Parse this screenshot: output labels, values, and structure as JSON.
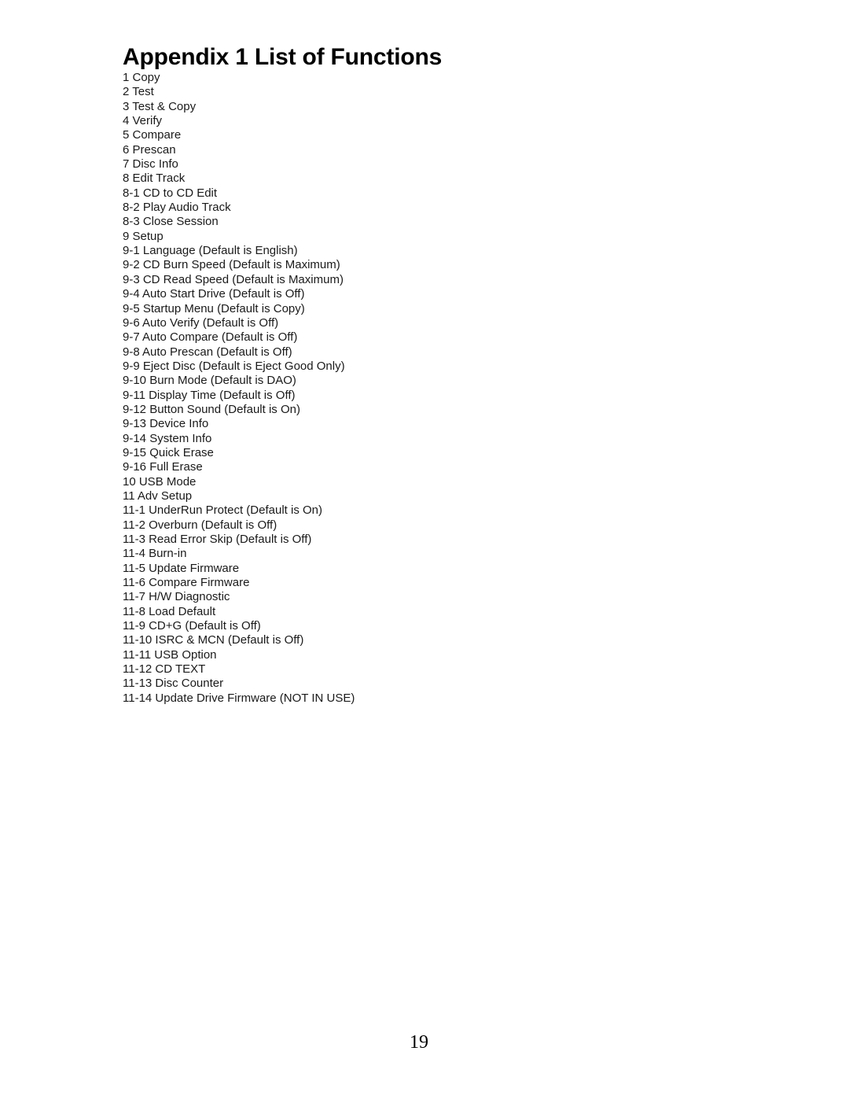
{
  "document": {
    "title": "Appendix 1 List of Functions",
    "page_number": "19",
    "background_color": "#ffffff",
    "text_color": "#1a1a1a"
  },
  "functions": [
    {
      "label": "1 Copy"
    },
    {
      "label": "2 Test"
    },
    {
      "label": "3 Test & Copy"
    },
    {
      "label": "4 Verify"
    },
    {
      "label": "5 Compare"
    },
    {
      "label": "6 Prescan"
    },
    {
      "label": "7 Disc Info"
    },
    {
      "label": "8 Edit Track"
    },
    {
      "label": "8-1 CD to CD Edit"
    },
    {
      "label": "8-2 Play Audio Track"
    },
    {
      "label": "8-3 Close Session"
    },
    {
      "label": "9 Setup"
    },
    {
      "label": "9-1 Language (Default is English)"
    },
    {
      "label": "9-2 CD Burn Speed (Default is Maximum)"
    },
    {
      "label": "9-3 CD Read Speed (Default is Maximum)"
    },
    {
      "label": "9-4 Auto Start Drive (Default is Off)"
    },
    {
      "label": "9-5 Startup Menu (Default is Copy)"
    },
    {
      "label": "9-6 Auto Verify (Default is Off)"
    },
    {
      "label": "9-7 Auto Compare (Default is Off)"
    },
    {
      "label": "9-8 Auto Prescan (Default is Off)"
    },
    {
      "label": "9-9 Eject Disc (Default is Eject Good Only)"
    },
    {
      "label": "9-10 Burn Mode (Default is DAO)"
    },
    {
      "label": "9-11 Display Time (Default is Off)"
    },
    {
      "label": "9-12 Button Sound (Default is On)"
    },
    {
      "label": "9-13 Device Info"
    },
    {
      "label": "9-14 System Info"
    },
    {
      "label": "9-15 Quick Erase"
    },
    {
      "label": "9-16 Full Erase"
    },
    {
      "label": "10 USB Mode"
    },
    {
      "label": "11 Adv Setup"
    },
    {
      "label": "11-1 UnderRun Protect (Default is On)"
    },
    {
      "label": "11-2 Overburn (Default is Off)"
    },
    {
      "label": "11-3 Read Error Skip (Default is Off)"
    },
    {
      "label": "11-4 Burn-in"
    },
    {
      "label": "11-5 Update Firmware"
    },
    {
      "label": "11-6 Compare Firmware"
    },
    {
      "label": "11-7 H/W Diagnostic"
    },
    {
      "label": "11-8 Load Default"
    },
    {
      "label": "11-9 CD+G (Default is Off)"
    },
    {
      "label": "11-10 ISRC & MCN (Default is Off)"
    },
    {
      "label": "11-11 USB Option"
    },
    {
      "label": "11-12 CD TEXT"
    },
    {
      "label": "11-13 Disc Counter"
    },
    {
      "label": "11-14 Update Drive Firmware (NOT IN USE)"
    }
  ]
}
